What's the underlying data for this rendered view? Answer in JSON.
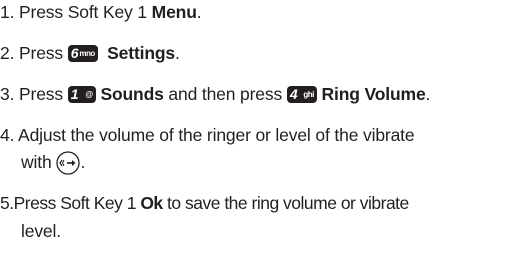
{
  "steps": [
    {
      "num": "1.",
      "pre": "Press Soft Key 1 ",
      "bold": "Menu",
      "post": "."
    },
    {
      "num": "2.",
      "pre": "Press ",
      "key": {
        "digit": "6",
        "glyph": "mno"
      },
      "bold": "Settings",
      "post": "."
    },
    {
      "num": "3.",
      "pre": "Press ",
      "key1": {
        "digit": "1",
        "glyph": "@"
      },
      "bold1": "Sounds",
      "mid": " and then press ",
      "key2": {
        "digit": "4",
        "glyph": "ghi"
      },
      "bold2": "Ring Volume",
      "post": "."
    },
    {
      "num": "4.",
      "line1": "Adjust the volume of the ringer or level of the vibrate",
      "line2": "with",
      "icon": "navigation-key-icon",
      "post": "."
    },
    {
      "num": "5.",
      "pre": "Press Soft Key 1 ",
      "bold": "Ok",
      "post": " to save the ring volume or vibrate",
      "line2": "level."
    }
  ]
}
